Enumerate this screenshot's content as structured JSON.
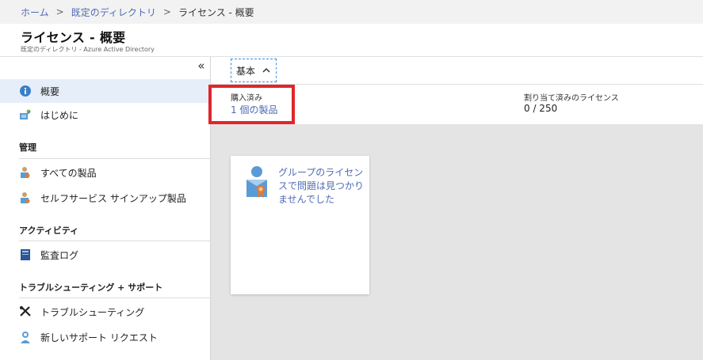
{
  "breadcrumb": {
    "home": "ホーム",
    "directory": "既定のディレクトリ",
    "current": "ライセンス - 概要",
    "separator": ">"
  },
  "header": {
    "title": "ライセンス - 概要",
    "subtitle": "既定のディレクトリ - Azure Active Directory"
  },
  "sidebar": {
    "collapse_glyph": "«",
    "items": {
      "overview": "概要",
      "getting_started": "はじめに",
      "all_products": "すべての製品",
      "self_service": "セルフサービス サインアップ製品",
      "audit_logs": "監査ログ",
      "troubleshooting": "トラブルシューティング",
      "new_support": "新しいサポート リクエスト"
    },
    "sections": {
      "manage": "管理",
      "activity": "アクティビティ",
      "troubleshoot_support": "トラブルシューティング + サポート"
    },
    "active": "overview"
  },
  "main": {
    "tab_label": "基本",
    "summary": {
      "purchased_label": "購入済み",
      "purchased_value": "1 個の製品",
      "assigned_label": "割り当て済みのライセンス",
      "assigned_value": "0 / 250"
    },
    "tile": {
      "message": "グループのライセンスで問題は見つかりませんでした"
    }
  },
  "colors": {
    "link": "#4f6bb5",
    "highlight": "#e0262b",
    "active_nav": "#e5eef9",
    "canvas": "#e4e4e4"
  }
}
